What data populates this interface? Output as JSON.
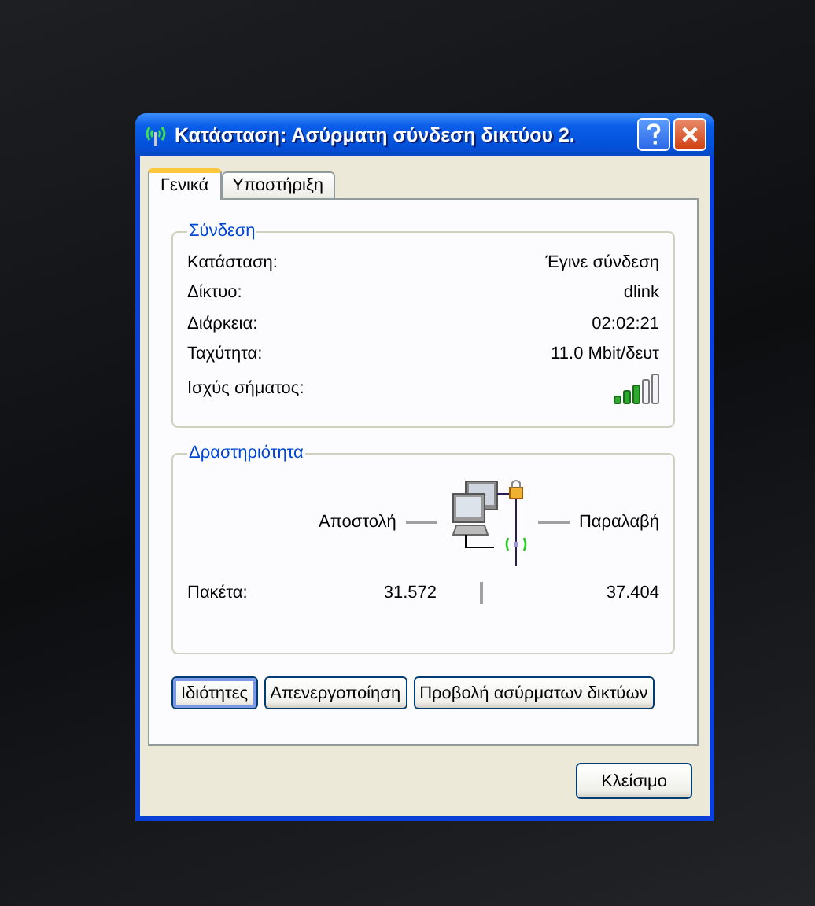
{
  "window": {
    "title": "Κατάσταση: Ασύρματη σύνδεση δικτύου 2."
  },
  "tabs": [
    {
      "label": "Γενικά",
      "selected": true
    },
    {
      "label": "Υποστήριξη",
      "selected": false
    }
  ],
  "connection": {
    "title": "Σύνδεση",
    "rows": [
      {
        "label": "Κατάσταση:",
        "value": "Έγινε σύνδεση"
      },
      {
        "label": "Δίκτυο:",
        "value": "dlink"
      },
      {
        "label": "Διάρκεια:",
        "value": "02:02:21"
      },
      {
        "label": "Ταχύτητα:",
        "value": "11.0 Mbit/δευτ"
      }
    ],
    "signal_label": "Ισχύς σήματος:"
  },
  "activity": {
    "title": "Δραστηριότητα",
    "sent_label": "Αποστολή",
    "received_label": "Παραλαβή",
    "packets_label": "Πακέτα:",
    "sent": "31.572",
    "received": "37.404"
  },
  "buttons": [
    {
      "label": "Ιδιότητες",
      "default": true
    },
    {
      "label": "Απενεργοποίηση",
      "default": false
    },
    {
      "label": "Προβολή ασύρματων δικτύων",
      "default": false
    }
  ],
  "close_button": "Κλείσιμο"
}
